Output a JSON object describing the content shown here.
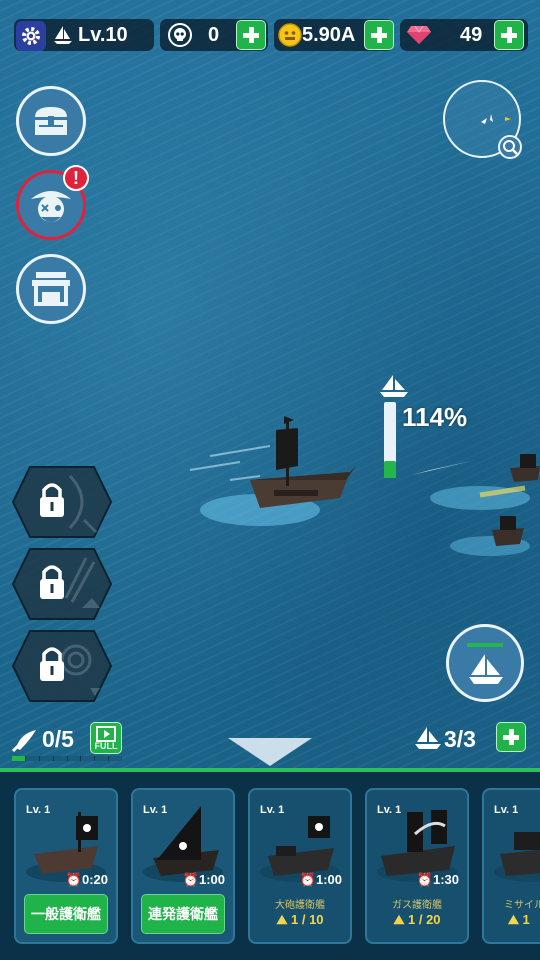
{
  "topbar": {
    "level": "Lv.10",
    "skulls": "0",
    "gold": "5.90A",
    "gems": "49"
  },
  "fleet": {
    "power_percent": "114%",
    "gauge_fill": 0.22
  },
  "missiles": {
    "count": "0/5",
    "full_label": "FULL",
    "segments_total": 8,
    "segments_filled": 1
  },
  "ships": {
    "count": "3/3"
  },
  "cards": [
    {
      "level": "Lv. 1",
      "timer": "0:20",
      "button": "一般護衛艦"
    },
    {
      "level": "Lv. 1",
      "timer": "1:00",
      "button": "連発護衛艦"
    },
    {
      "level": "Lv. 1",
      "timer": "1:00",
      "name": "大砲護衛艦",
      "progress": "1 / 10"
    },
    {
      "level": "Lv. 1",
      "timer": "1:30",
      "name": "ガス護衛艦",
      "progress": "1 / 20"
    },
    {
      "level": "Lv. 1",
      "name": "ミサイル",
      "progress": "1"
    }
  ],
  "colors": {
    "accent_green": "#1fb34a",
    "alert_red": "#e0223a",
    "panel": "#0b3148"
  },
  "icons": [
    "gear-icon",
    "sailboat-icon",
    "skull-icon",
    "coin-icon",
    "gem-icon",
    "chest-icon",
    "pirate-icon",
    "shop-icon",
    "lock-icon",
    "search-icon",
    "missile-icon",
    "video-icon",
    "clock-icon"
  ]
}
